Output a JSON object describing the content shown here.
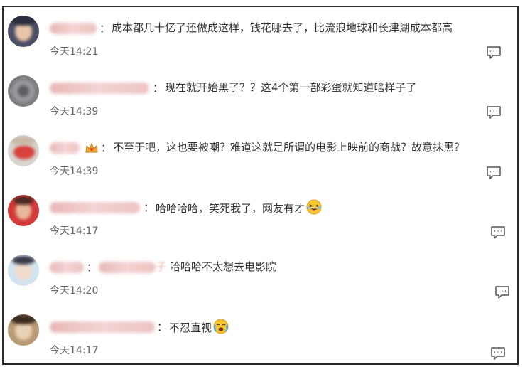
{
  "comments": [
    {
      "text": "成本都几十亿了还做成这样，钱花哪去了，比流浪地球和长津湖成本都高",
      "time": "今天14:21"
    },
    {
      "text": "现在就开始黑了？？这4个第一部彩蛋就知道啥样子了",
      "time": "今天14:39"
    },
    {
      "text": "不至于吧，这也要被嘲？难道这就是所谓的电影上映前的商战？故意抹黑？",
      "time": "今天14:39"
    },
    {
      "text": "哈哈哈哈，笑死我了，网友有才",
      "time": "今天14:17"
    },
    {
      "mention": "子",
      "text": "哈哈哈不太想去电影院",
      "time": "今天14:20"
    },
    {
      "text": "不忍直视",
      "time": "今天14:17"
    }
  ],
  "colon": "：",
  "colors": {
    "text": "#333333",
    "time": "#666666",
    "border": "#2b2b2b",
    "icon": "#555555"
  },
  "icons": {
    "reply": "comment-bubble-icon",
    "emoji_laugh": "laughing-emoji",
    "emoji_cry": "crying-laughing-emoji",
    "badge": "crown-badge-icon"
  }
}
